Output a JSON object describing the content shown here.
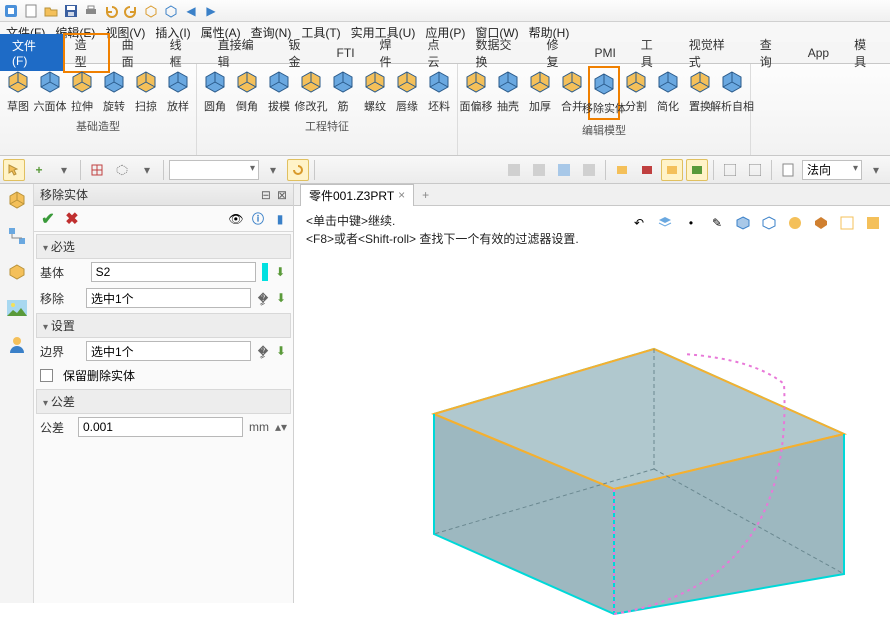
{
  "menubar": [
    "文件(F)",
    "编辑(E)",
    "视图(V)",
    "插入(I)",
    "属性(A)",
    "查询(N)",
    "工具(T)",
    "实用工具(U)",
    "应用(P)",
    "窗口(W)",
    "帮助(H)"
  ],
  "tabs": [
    "文件(F)",
    "造型",
    "曲面",
    "线框",
    "直接编辑",
    "钣金",
    "FTI",
    "焊件",
    "点云",
    "数据交换",
    "修复",
    "PMI",
    "工具",
    "视觉样式",
    "查询",
    "App",
    "模具"
  ],
  "active_tab_index": 0,
  "highlight_tab_index": 1,
  "ribbon_groups": [
    {
      "label": "基础造型",
      "buttons": [
        "草图",
        "六面体",
        "拉伸",
        "旋转",
        "扫掠",
        "放样"
      ]
    },
    {
      "label": "工程特征",
      "buttons": [
        "圆角",
        "倒角",
        "拔模",
        "修改孔",
        "筋",
        "螺纹",
        "唇缘",
        "坯料"
      ]
    },
    {
      "label": "编辑模型",
      "buttons": [
        "面偏移",
        "抽壳",
        "加厚",
        "合并",
        "移除实体",
        "分割",
        "简化",
        "置换",
        "解析自相"
      ]
    }
  ],
  "highlight_ribbon": {
    "group": 2,
    "btn": 4
  },
  "toolbar2_combo1": "",
  "toolbar2_combo2": "法向",
  "panel": {
    "title": "移除实体",
    "sections": {
      "required": {
        "hdr": "必选",
        "base_lbl": "基体",
        "base_val": "S2",
        "remove_lbl": "移除",
        "remove_val": "选中1个"
      },
      "settings": {
        "hdr": "设置",
        "boundary_lbl": "边界",
        "boundary_val": "选中1个",
        "keep_lbl": "保留删除实体"
      },
      "tolerance": {
        "hdr": "公差",
        "tol_lbl": "公差",
        "tol_val": "0.001",
        "tol_unit": "mm"
      }
    }
  },
  "doc_tab": "零件001.Z3PRT",
  "hints": [
    "<单击中键>继续.",
    "<F8>或者<Shift-roll> 查找下一个有效的过滤器设置."
  ]
}
